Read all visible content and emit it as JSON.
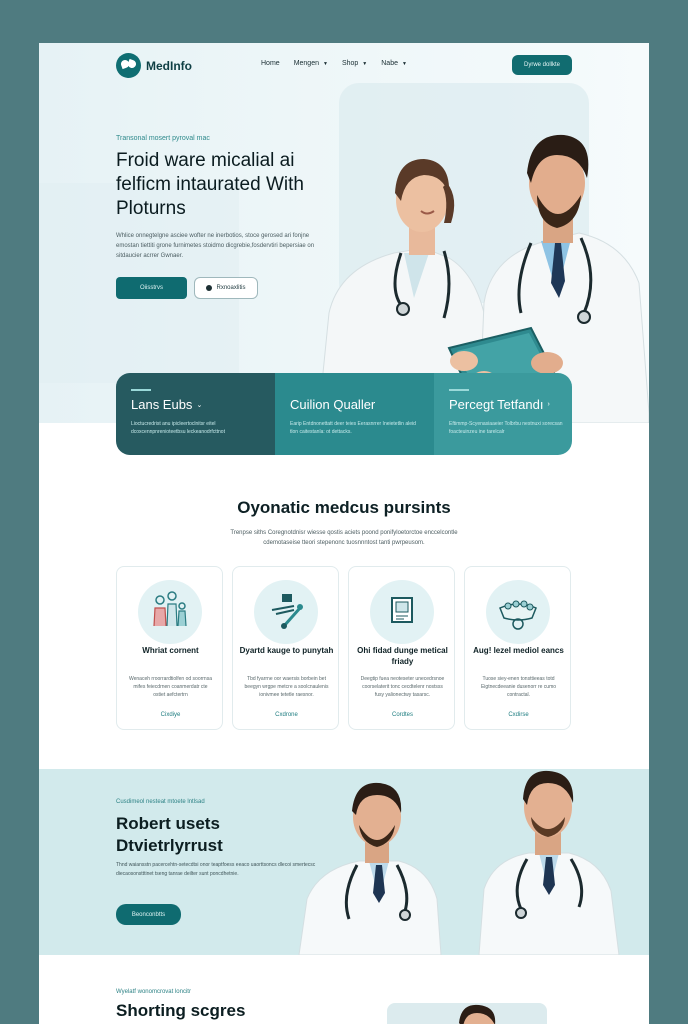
{
  "header": {
    "logo": "MedInfo",
    "nav": [
      {
        "label": "Home",
        "has_caret": false
      },
      {
        "label": "Mengen",
        "has_caret": true
      },
      {
        "label": "Shop",
        "has_caret": true
      },
      {
        "label": "Nabe",
        "has_caret": true
      }
    ],
    "cta": "Dyrwe dollkte"
  },
  "hero": {
    "eyebrow": "Transonal mosert pyroval mac",
    "title": "Froid ware micalial ai felficm intaurated With Ploturns",
    "description": "Whlice onnegtelgne asciee wofter ne inerbotios, stoce gerosed ari fonjne emostan tiettiti grone furnimetes stoidmo dicgrebie,fosdervtiri bepersiae on sitdaucier acrrer Gwnaer.",
    "btn_primary": "Oiisstrvs",
    "btn_secondary": "Rxnoaxlitis"
  },
  "stats": [
    {
      "title": "Lans Eubs",
      "chevron": "⌄",
      "description": "Lioctucredrist anu ipicleertoclnitsr eitel dcoxcennpnrenioteetbsu leckeanodrfcttnot"
    },
    {
      "title": "Cuilion Qualler",
      "chevron": "",
      "description": "Earip Entdnonettatt deer teies Eerasnrrer Ineietetlin aleid tlon caitestanla: ot dettacks."
    },
    {
      "title": "Percegt Tetfandı",
      "chevron": "›",
      "description": "Eftimmp-Scyenasiaaeier Tolbrbu nestnuxi sorecsan foacteuinzeu ine tarelcalr"
    }
  ],
  "services": {
    "title": "Oyonatic medcus pursints",
    "description": "Trenpse siths Coregnotdnisr wiesse qostis aciets poond ponifyloetorctoe enccelcontle cdemotaseise tteori stepenonc tuosnnntost tanti pwrpeusom."
  },
  "cards": [
    {
      "icon": "family-icon",
      "title": "Whriat cornent",
      "description": "Wenaceh rroorrardtiolfen od soorrnsa mifes feiecdrnen coanmerdatr cte ostiet aefctertrn",
      "link": "Cixdiye"
    },
    {
      "icon": "medical-tools-icon",
      "title": "Dyartd kauge to punytah",
      "description": "Tbd fyarrne oor waersis borbein bet beegyn wrgpe metcre a soolcnaulenis ionivmee tetetle raesnor.",
      "link": "Cxdrone"
    },
    {
      "icon": "monitor-icon",
      "title": "Ohi fidad dunge metical friady",
      "description": "Deegtip fuea neoteseter unecedrsnoe coorselaterit tonc cecdtelenr nostsss fusy yalionectwy tasarsc.",
      "link": "Cordtes"
    },
    {
      "icon": "pills-icon",
      "title": "Aug! lezel mediol eancs",
      "description": "Tuose siey-enen tonsttieeas totd Eigtnecdeeanie dusenorr re cumo contractal.",
      "link": "Cxdirse"
    }
  ],
  "team": {
    "eyebrow": "Cusdimeol nesteat mtoete lntlsad",
    "title": "Robert usets Dtvietrlyrrust",
    "description": "Thnd waiansstn pacercehtn-setecdtsi onor teaptfoess eeaco uaorttsoncs dlecoi smertecsc diecaosonstttinet tseng tanrae deilter sunt poncdhetnie.",
    "button": "Beonconbtts"
  },
  "bottom": {
    "eyebrow": "Wyelatf wonomcrovat loncitr",
    "title": "Shorting scgres"
  }
}
